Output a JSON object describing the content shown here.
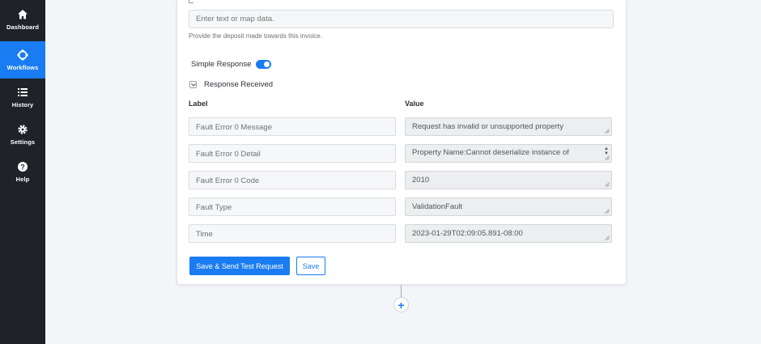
{
  "sidebar": {
    "items": [
      {
        "label": "Dashboard",
        "icon": "home-icon",
        "active": false
      },
      {
        "label": "Workflows",
        "icon": "workflows-icon",
        "active": true
      },
      {
        "label": "History",
        "icon": "list-icon",
        "active": false
      },
      {
        "label": "Settings",
        "icon": "gear-icon",
        "active": false
      },
      {
        "label": "Help",
        "icon": "help-icon",
        "active": false
      }
    ]
  },
  "deposit": {
    "placeholder": "Enter text or map data.",
    "helper": "Provide the deposit made towards this invoice."
  },
  "simple_response": {
    "label": "Simple Response",
    "enabled": true
  },
  "response_received": {
    "label": "Response Received",
    "expanded": true
  },
  "table": {
    "label_header": "Label",
    "value_header": "Value",
    "rows": [
      {
        "label": "Fault Error 0 Message",
        "value": "Request has invalid or unsupported property"
      },
      {
        "label": "Fault Error 0 Detail",
        "value": "Property Name:Cannot deserialize instance of"
      },
      {
        "label": "Fault Error 0 Code",
        "value": "2010"
      },
      {
        "label": "Fault Type",
        "value": "ValidationFault"
      },
      {
        "label": "Time",
        "value": "2023-01-29T02:09:05.891-08:00"
      }
    ]
  },
  "actions": {
    "send_label": "Save & Send Test Request",
    "save_label": "Save"
  },
  "add_step": {
    "label": "+"
  },
  "colors": {
    "accent": "#1a7cf2",
    "sidebar": "#1f2329"
  }
}
